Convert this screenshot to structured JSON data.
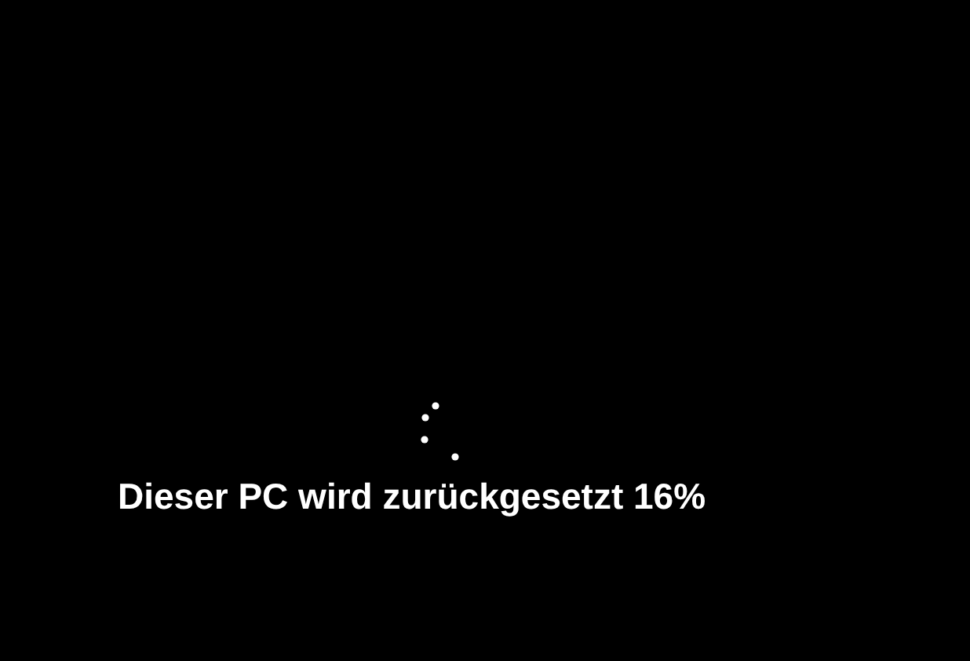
{
  "status": {
    "message": "Dieser PC wird zurückgesetzt 16%"
  }
}
